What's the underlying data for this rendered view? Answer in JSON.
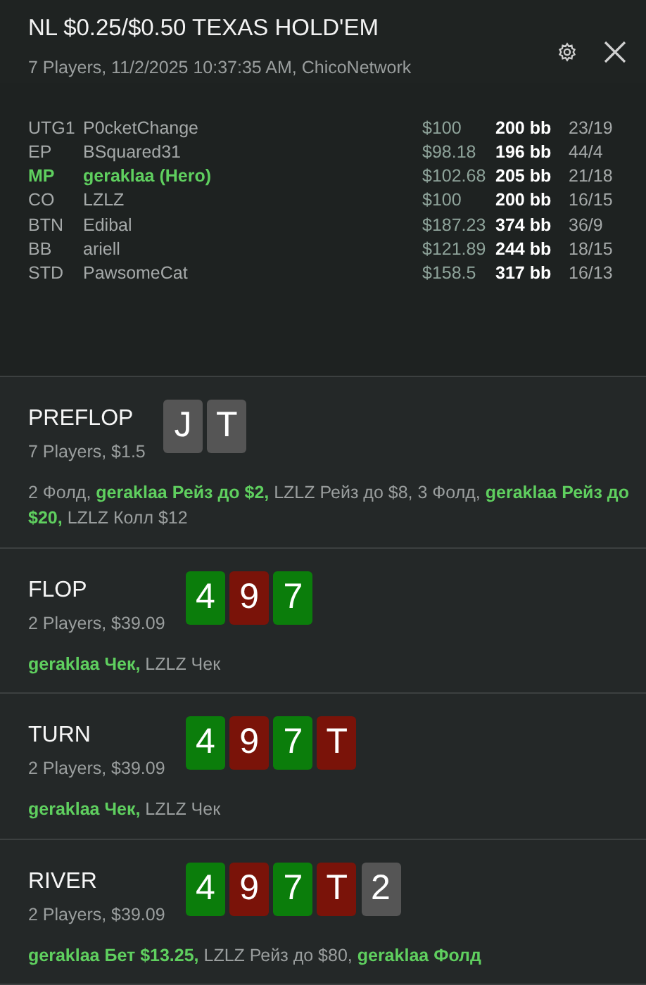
{
  "header": {
    "title": "NL $0.25/$0.50 TEXAS HOLD'EM",
    "subtitle": "7 Players, 11/2/2025 10:37:35 AM, ChicoNetwork"
  },
  "players": [
    {
      "position": "UTG1",
      "name": "P0cketChange",
      "stack": "$100",
      "bb": "200 bb",
      "stats": "23/19",
      "hero": false
    },
    {
      "position": "EP",
      "name": "BSquared31",
      "stack": "$98.18",
      "bb": "196 bb",
      "stats": "44/4",
      "hero": false
    },
    {
      "position": "MP",
      "name": "geraklaa (Hero)",
      "stack": "$102.68",
      "bb": "205 bb",
      "stats": "21/18",
      "hero": true
    },
    {
      "position": "CO",
      "name": "LZLZ",
      "stack": "$100",
      "bb": "200 bb",
      "stats": "16/15",
      "hero": false
    },
    {
      "position": "BTN",
      "name": "Edibal",
      "stack": "$187.23",
      "bb": "374 bb",
      "stats": "36/9",
      "hero": false
    },
    {
      "position": "BB",
      "name": "ariell",
      "stack": "$121.89",
      "bb": "244 bb",
      "stats": "18/15",
      "hero": false
    },
    {
      "position": "STD",
      "name": "PawsomeCat",
      "stack": "$158.5",
      "bb": "317 bb",
      "stats": "16/13",
      "hero": false
    }
  ],
  "streets": [
    {
      "name": "PREFLOP",
      "info": "7 Players, $1.5",
      "cards": [
        {
          "rank": "J",
          "color": "#555555"
        },
        {
          "rank": "T",
          "color": "#555555"
        }
      ],
      "actions": [
        {
          "text": "2 Фолд, ",
          "hero": false
        },
        {
          "text": "geraklaa Рейз до $2, ",
          "hero": true
        },
        {
          "text": "LZLZ Рейз до $8, 3 Фолд, ",
          "hero": false
        },
        {
          "text": "geraklaa Рейз до $20, ",
          "hero": true
        },
        {
          "text": "LZLZ Колл $12",
          "hero": false
        }
      ]
    },
    {
      "name": "FLOP",
      "info": "2 Players, $39.09",
      "cards": [
        {
          "rank": "4",
          "color": "#0b7d0b"
        },
        {
          "rank": "9",
          "color": "#7a1309"
        },
        {
          "rank": "7",
          "color": "#0b7d0b"
        }
      ],
      "actions": [
        {
          "text": "geraklaa Чек, ",
          "hero": true
        },
        {
          "text": "LZLZ Чек",
          "hero": false
        }
      ]
    },
    {
      "name": "TURN",
      "info": "2 Players, $39.09",
      "cards": [
        {
          "rank": "4",
          "color": "#0b7d0b"
        },
        {
          "rank": "9",
          "color": "#7a1309"
        },
        {
          "rank": "7",
          "color": "#0b7d0b"
        },
        {
          "rank": "T",
          "color": "#7a1309"
        }
      ],
      "actions": [
        {
          "text": "geraklaa Чек, ",
          "hero": true
        },
        {
          "text": "LZLZ Чек",
          "hero": false
        }
      ]
    },
    {
      "name": "RIVER",
      "info": "2 Players, $39.09",
      "cards": [
        {
          "rank": "4",
          "color": "#0b7d0b"
        },
        {
          "rank": "9",
          "color": "#7a1309"
        },
        {
          "rank": "7",
          "color": "#0b7d0b"
        },
        {
          "rank": "T",
          "color": "#7a1309"
        },
        {
          "rank": "2",
          "color": "#555555"
        }
      ],
      "actions": [
        {
          "text": "geraklaa Бет $13.25, ",
          "hero": true
        },
        {
          "text": "LZLZ Рейз до $80, ",
          "hero": false
        },
        {
          "text": "geraklaa Фолд",
          "hero": true
        }
      ]
    }
  ]
}
